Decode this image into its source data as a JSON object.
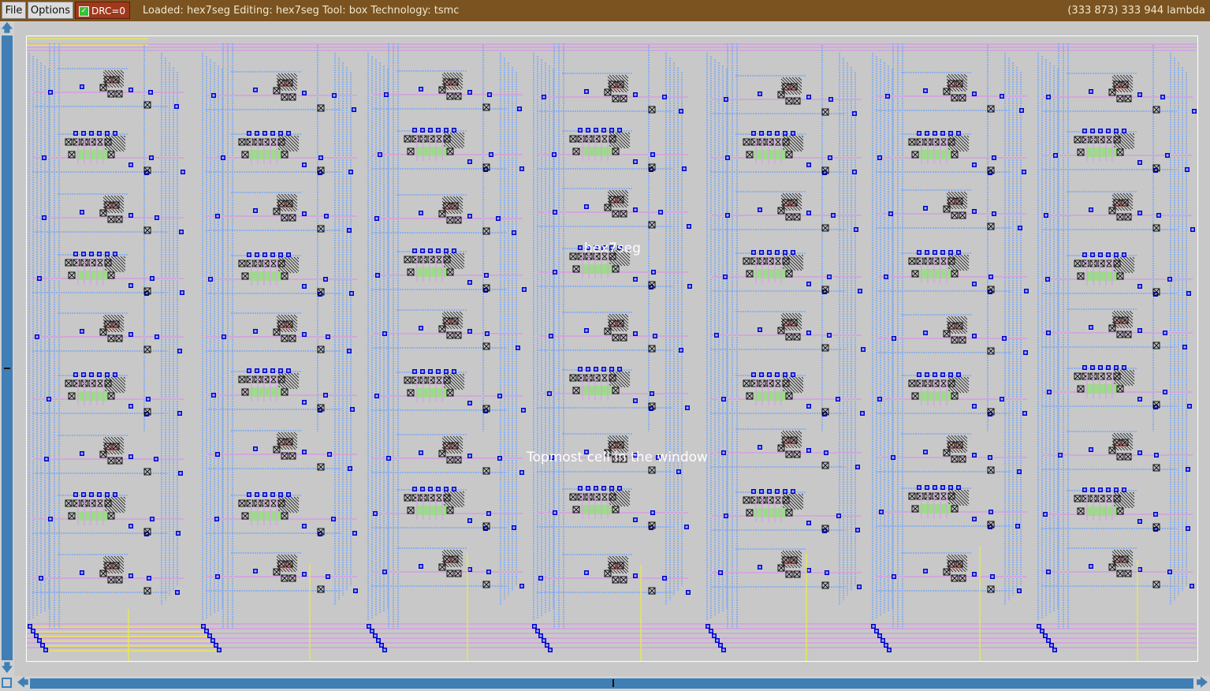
{
  "menu": {
    "file_label": "File",
    "options_label": "Options",
    "drc_label": "DRC=0",
    "drc_checked": true
  },
  "status": {
    "text": "Loaded: hex7seg Editing: hex7seg Tool: box  Technology: tsmc",
    "coordinates": "(333 873) 333 944 lambda"
  },
  "canvas": {
    "cell_label": "hex7seg",
    "hint": "Topmost cell in the window"
  },
  "icons": {
    "scroll_up": "arrow-up-icon",
    "scroll_down": "arrow-down-icon",
    "scroll_left": "arrow-left-icon",
    "scroll_right": "arrow-right-icon",
    "corner": "square-icon"
  },
  "colors": {
    "topbar": "#7a5320",
    "drc_button": "#a0381c",
    "scrollbar": "#3f7fb5",
    "canvas_bg": "#c8c8c8",
    "metal1": "#7ea7ef",
    "metal2": "#d2a8dc",
    "poly": "#e58a8a",
    "diffusion": "#9ddb8a",
    "contact": "#101010",
    "via": "#0000cc",
    "rail": "#e6e65a"
  }
}
